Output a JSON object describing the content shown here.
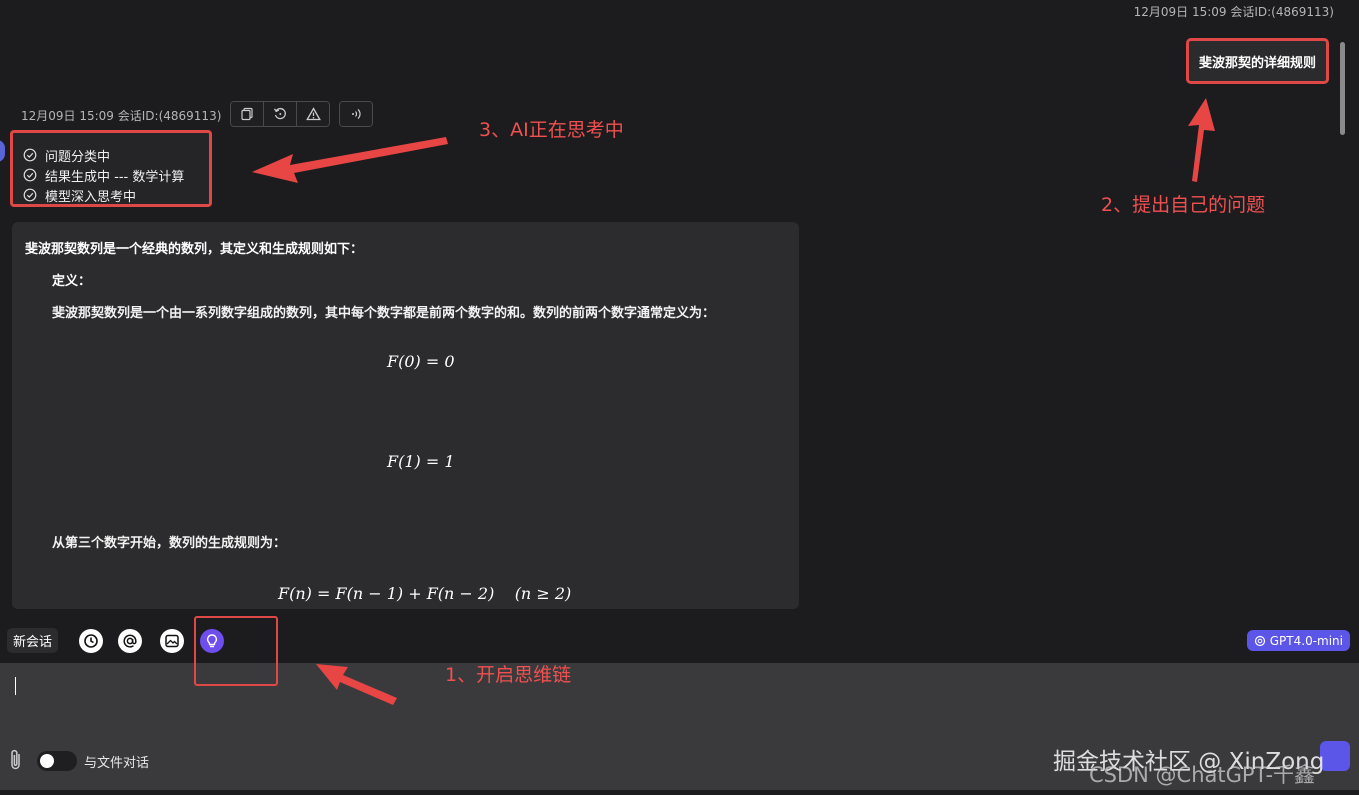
{
  "user_message": {
    "meta": "12月09日 15:09 会话ID:(4869113)",
    "text": "斐波那契的详细规则"
  },
  "ai_message": {
    "meta": "12月09日 15:09 会话ID:(4869113)",
    "actions": [
      "copy-icon",
      "refresh-icon",
      "warning-icon",
      "speaker-icon"
    ],
    "steps": [
      {
        "label": "问题分类中",
        "icon": "check-circle-icon"
      },
      {
        "label": "结果生成中 --- 数学计算",
        "icon": "check-circle-icon"
      },
      {
        "label": "模型深入思考中",
        "icon": "check-circle-icon"
      }
    ],
    "answer": {
      "intro": "斐波那契数列是一个经典的数列，其定义和生成规则如下：",
      "definition_heading": "定义：",
      "definition_text": "斐波那契数列是一个由一系列数字组成的数列，其中每个数字都是前两个数字的和。数列的前两个数字通常定义为：",
      "eq1": "F(0) = 0",
      "eq2": "F(1) = 1",
      "rule_text": "从第三个数字开始，数列的生成规则为：",
      "eq3": "F(n) = F(n − 1) + F(n − 2)    (n ≥ 2)"
    }
  },
  "toolbar": {
    "new_chat": "新会话",
    "tools": [
      "history-icon",
      "at-icon",
      "image-icon",
      "lightbulb-icon"
    ],
    "model": "GPT4.0-mini"
  },
  "input": {
    "value": "",
    "placeholder": "",
    "file_chat_label": "与文件对话",
    "file_chat_enabled": false
  },
  "annotations": {
    "note1": "1、开启思维链",
    "note2": "2、提出自己的问题",
    "note3": "3、AI正在思考中",
    "color": "#e04848"
  },
  "watermark": {
    "line1": "掘金技术社区 @ XinZong",
    "line2": "CSDN @ChatGPT-千鑫"
  },
  "colors": {
    "accent": "#5b55e8",
    "background": "#1c1c1e",
    "card": "#2c2c2e"
  }
}
